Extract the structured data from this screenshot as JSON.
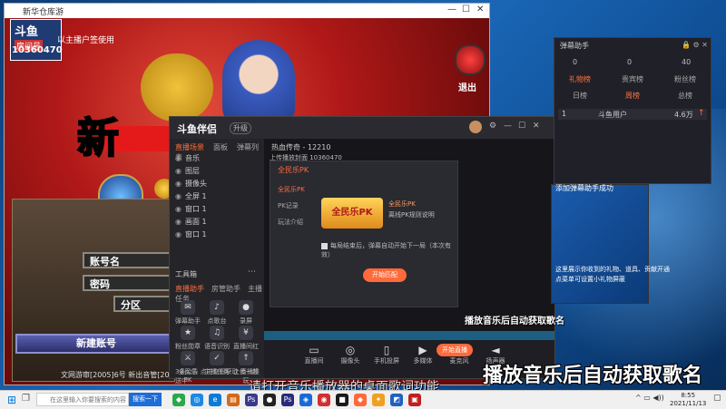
{
  "game": {
    "window_title": "新华仓库游",
    "badge_top": "斗鱼",
    "badge_room": "房间号",
    "room_id": "10360470",
    "notice": "以主播户签使用",
    "logo_text": "新",
    "exit_label": "退出",
    "account_label": "账号名",
    "password_label": "密码",
    "zone_label": "分区",
    "new_account_button": "新建账号",
    "footer": "文网游审[2005]6号  新出音管[2004]452号"
  },
  "app": {
    "name": "斗鱼伴侣",
    "version": "升级",
    "left_tabs": [
      "直播场景",
      "面板",
      "弹幕列表"
    ],
    "room_title": "热血传奇 - 12210",
    "room_id_line": "上传播放封面  10360470",
    "sources": [
      "音乐",
      "图层",
      "摄像头",
      "全屏 1",
      "窗口 1",
      "画面 1",
      "窗口 1"
    ],
    "tools_title": "工具箱",
    "tools_tabs": [
      "直播助手",
      "房管助手",
      "主播任务"
    ],
    "tools": [
      "弹幕助手",
      "点歌台",
      "录屏",
      "粉丝勋章",
      "语音识别",
      "直播间红包",
      "全民乐PK",
      "主播任务",
      "上传一起玩"
    ],
    "sidebar_footer": "3条公告  点击立即获取  直播推送中",
    "dialog": {
      "title": "全民乐PK",
      "tabs": [
        "全民乐PK",
        "PK记录",
        "玩法介绍"
      ],
      "pk_image_text": "全民乐PK",
      "pk_name": "全民乐PK",
      "pk_desc": "离线PK规则说明",
      "checkbox_label": "每局结束后，弹幕自动开始下一局（本次有效）",
      "start_button": "开始匹配"
    },
    "bottom_buttons": [
      "直播间",
      "摄像头",
      "手机投屏",
      "多媒体",
      "麦克风",
      "扬声器"
    ],
    "live_button": "开始直播",
    "overlay_caption": "播放音乐后自动获取歌名"
  },
  "assistant": {
    "title": "弹幕助手",
    "stats": [
      "0",
      "0",
      "40"
    ],
    "tabs": [
      "礼物榜",
      "贵宾榜",
      "粉丝榜"
    ],
    "subtabs": [
      "日榜",
      "周榜",
      "总榜"
    ],
    "row": {
      "rank": "1",
      "user": "斗鱼用户",
      "value": "4.6万"
    },
    "added_text": "添加弹幕助手成功",
    "side_text": "这里展示你收到的礼物、道具、贡献开通点菜单可设置小礼物屏蔽"
  },
  "captions": {
    "big": "播放音乐后自动获取歌名",
    "sub": "请打开音乐播放器的桌面歌词功能"
  },
  "taskbar": {
    "search_placeholder": "在这里输入你要搜索的内容",
    "search_button": "搜索一下",
    "time": "8:55",
    "date": "2021/11/13"
  }
}
